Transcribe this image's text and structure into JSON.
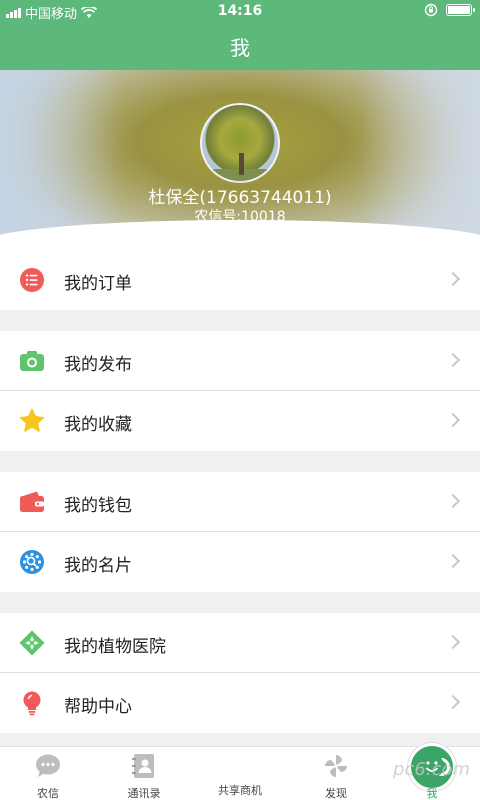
{
  "status": {
    "carrier": "中国移动",
    "time": "14:16"
  },
  "nav": {
    "title": "我"
  },
  "profile": {
    "name": "杜保全(17663744011)",
    "account": "农信号:10018"
  },
  "menu": [
    {
      "label": "我的订单",
      "icon": "list-icon",
      "color": "#f05a57"
    },
    {
      "label": "我的发布",
      "icon": "camera-icon",
      "color": "#5fc46e"
    },
    {
      "label": "我的收藏",
      "icon": "star-icon",
      "color": "#f7c51d"
    },
    {
      "label": "我的钱包",
      "icon": "wallet-icon",
      "color": "#f05a57"
    },
    {
      "label": "我的名片",
      "icon": "card-search-icon",
      "color": "#2d8fe0"
    },
    {
      "label": "我的植物医院",
      "icon": "plant-hospital-icon",
      "color": "#5fc46e"
    },
    {
      "label": "帮助中心",
      "icon": "bulb-icon",
      "color": "#f05a57"
    }
  ],
  "tabs": [
    {
      "label": "农信",
      "icon": "chat-icon"
    },
    {
      "label": "通讯录",
      "icon": "contacts-icon"
    },
    {
      "label": "共享商机",
      "icon": "rings-icon"
    },
    {
      "label": "发现",
      "icon": "pinwheel-icon"
    },
    {
      "label": "我",
      "icon": "me-icon",
      "active": true
    }
  ],
  "watermark": "pc6.com",
  "colors": {
    "primary": "#5db87c",
    "tab_active": "#3aa567"
  }
}
